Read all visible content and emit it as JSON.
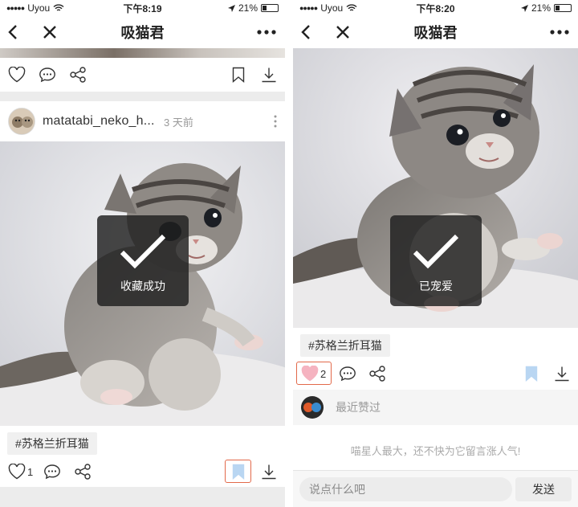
{
  "status_bar": {
    "carrier": "Uyou",
    "battery": "21%"
  },
  "left": {
    "time": "下午8:19",
    "title": "吸猫君",
    "post": {
      "username": "matatabi_neko_h...",
      "time_ago": "3 天前",
      "toast": "收藏成功",
      "tag": "#苏格兰折耳猫",
      "like_count": "1"
    }
  },
  "right": {
    "time": "下午8:20",
    "title": "吸猫君",
    "toast": "已宠爱",
    "tag": "#苏格兰折耳猫",
    "like_count": "2",
    "recent_likes_label": "最近赞过",
    "empty_comments": "喵星人最大，还不快为它留言涨人气!",
    "comment_placeholder": "说点什么吧",
    "send_label": "发送"
  },
  "colors": {
    "highlight": "#e2694a",
    "liked_heart": "#f5b3c0",
    "bookmark_active": "#b9d6f2"
  },
  "icons": [
    "back-icon",
    "close-icon",
    "more-icon",
    "heart-icon",
    "comment-icon",
    "share-icon",
    "bookmark-icon",
    "download-icon",
    "checkmark-icon"
  ]
}
